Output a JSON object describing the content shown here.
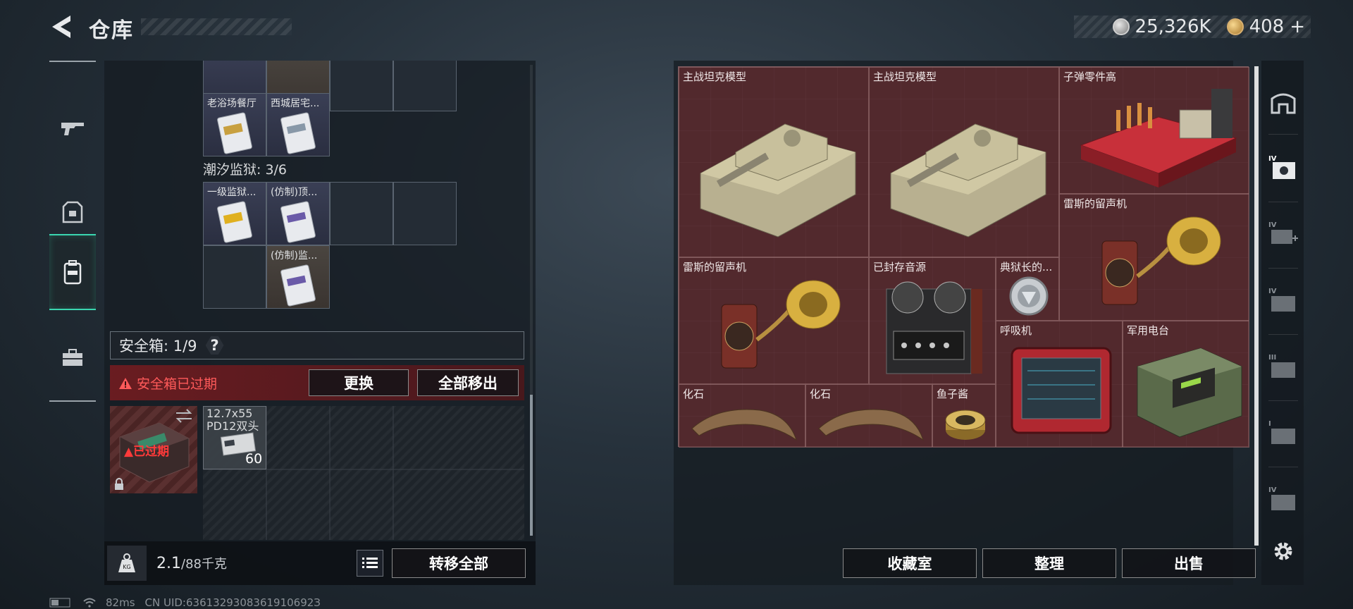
{
  "topbar": {
    "title": "仓库"
  },
  "currency": {
    "silver": "25,326K",
    "gold": "408",
    "gold_plus": "+"
  },
  "left_nav": [
    {
      "icon": "gun-icon"
    },
    {
      "icon": "armor-icon"
    },
    {
      "icon": "backpack-icon",
      "active": true
    },
    {
      "icon": "briefcase-icon"
    }
  ],
  "inventory": {
    "row1_labels": [
      "老浴场餐厅",
      "西城居宅..."
    ],
    "prison_section": "潮汐监狱: 3/6",
    "prison_labels": [
      "一级监狱...",
      "(仿制)顶...",
      "(仿制)监..."
    ]
  },
  "safebox": {
    "label": "安全箱: 1/9",
    "help": "?",
    "expired_notice": "安全箱已过期",
    "replace_button": "更换",
    "remove_all_button": "全部移出",
    "expired_badge": "已过期"
  },
  "ammo": {
    "name_line1": "12.7x55",
    "name_line2": "PD12双头",
    "count": "60"
  },
  "weight": {
    "current": "2.1",
    "max": "/88千克",
    "icon_text": "KG"
  },
  "transfer_all_button": "转移全部",
  "stash_items": [
    {
      "id": "tank1",
      "label": "主战坦克模型"
    },
    {
      "id": "tank2",
      "label": "主战坦克模型"
    },
    {
      "id": "ammo_parts",
      "label": "子弹零件高"
    },
    {
      "id": "gramophone_r",
      "label": "雷斯的留声机"
    },
    {
      "id": "gramophone_l",
      "label": "雷斯的留声机"
    },
    {
      "id": "tape",
      "label": "已封存音源"
    },
    {
      "id": "warden",
      "label": "典狱长的..."
    },
    {
      "id": "ventilator",
      "label": "呼吸机"
    },
    {
      "id": "radio",
      "label": "军用电台"
    },
    {
      "id": "fossil1",
      "label": "化石"
    },
    {
      "id": "fossil2",
      "label": "化石"
    },
    {
      "id": "caviar",
      "label": "鱼子酱"
    }
  ],
  "bottom_buttons": {
    "collection": "收藏室",
    "sort": "整理",
    "sell": "出售"
  },
  "right_rail": [
    {
      "icon": "home-icon",
      "tier": ""
    },
    {
      "icon": "safe-icon",
      "tier": "IV"
    },
    {
      "icon": "medkit-icon",
      "tier": "IV"
    },
    {
      "icon": "case-icon",
      "tier": "IV"
    },
    {
      "icon": "case-icon",
      "tier": "III"
    },
    {
      "icon": "case-icon",
      "tier": "I"
    },
    {
      "icon": "case-icon",
      "tier": "IV"
    }
  ],
  "status": {
    "ping": "82ms",
    "uid": "CN UID:6361329308361910692З"
  },
  "colors": {
    "accent": "#3ad6b0",
    "danger": "#ff5a5a",
    "stash_bg": "#4a2a30"
  }
}
